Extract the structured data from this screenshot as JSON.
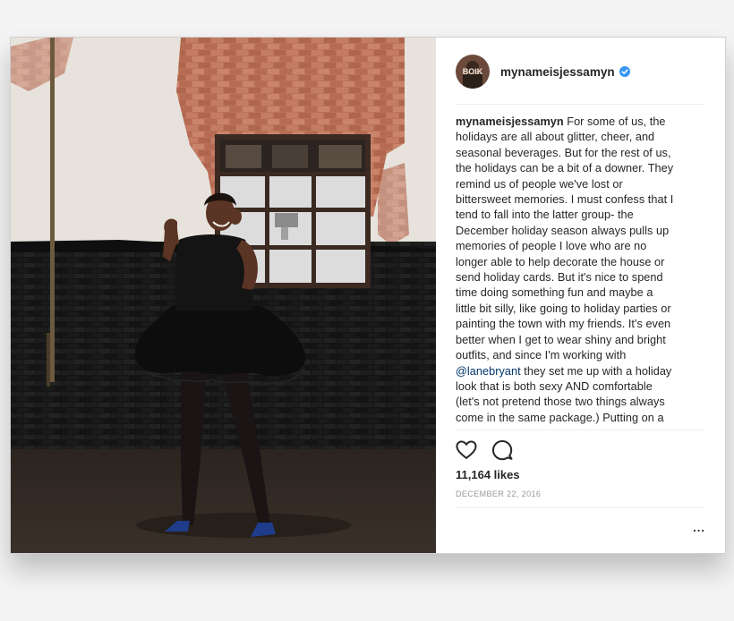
{
  "post": {
    "username": "mynameisjessamyn",
    "verified_icon": "verified-badge-icon",
    "caption_lines": [
      "For some of us, the",
      "holidays are all about glitter, cheer, and",
      "seasonal beverages. But for the rest of us,",
      "the holidays can be a bit of a downer. They",
      "remind us of people we've lost or",
      "bittersweet memories. I must confess that I",
      "tend to fall into the latter group- the",
      "December holiday season always pulls up",
      "memories of people I love who are no",
      "longer able to help decorate the house or",
      "send holiday cards. But it's nice to spend",
      "time doing something fun and maybe a",
      "little bit silly, like going to holiday parties or",
      "painting the town with my friends. It's even",
      "better when I get to wear shiny and bright",
      "outfits, and since I'm working with"
    ],
    "mention": "@lanebryant",
    "caption_after_mention": " they set me up with a holiday",
    "caption_tail_lines": [
      "look that is both sexy AND comfortable",
      "(let's not pretend those two things always",
      "come in the same package.) Putting on a"
    ],
    "likes": "11,164 likes",
    "date": "DECEMBER 22, 2016",
    "more_label": "...",
    "avatar_text": "BOIK"
  },
  "colors": {
    "verified": "#3897f0",
    "text": "#262626",
    "muted": "#999999"
  }
}
